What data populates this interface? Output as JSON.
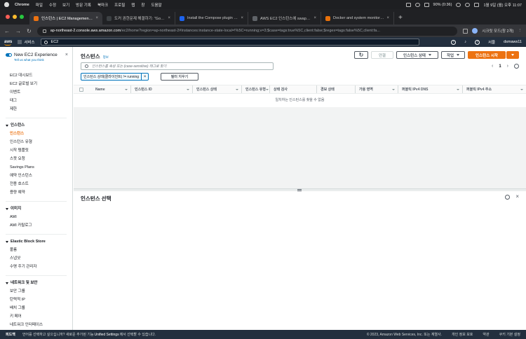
{
  "menubar": {
    "app": "Chrome",
    "items": [
      "파일",
      "수정",
      "보기",
      "방문 기록",
      "북마크",
      "프로필",
      "탭",
      "창",
      "도움말"
    ],
    "battery": "90% (0:36)",
    "datetime": "1월 9일 (월) 오후 11:07"
  },
  "tabs": [
    {
      "title": "인스턴스 | EC2 Management Co",
      "color": "#ec7211",
      "active": true
    },
    {
      "title": "도커 권한문제 해결하기: \"Got perm",
      "color": "#3c4043",
      "active": false
    },
    {
      "title": "Install the Compose plugin | Do",
      "color": "#1d63ed",
      "active": false
    },
    {
      "title": "AWS EC2 인스턴스에 swap 추가하",
      "color": "#5f6368",
      "active": false
    },
    {
      "title": "Docker and system monitoring",
      "color": "#e8710a",
      "active": false
    }
  ],
  "addressbar": {
    "host": "ap-northeast-2.console.aws.amazon.com",
    "path": "/ec2/home?region=ap-northeast-2#Instances:instance-state-local=!%5C=running;v=3;$case=tags:true%5C,client:false;$regex=tags:false%5C,client:fa...",
    "profile": "시크릿 모드(창 2개)"
  },
  "awsnav": {
    "logo": "aws",
    "services": "서비스",
    "search_value": "EC2",
    "region": "서울",
    "user": "dsmaws11"
  },
  "sidebar": {
    "title": "New EC2 Experience",
    "subtitle": "Tell us what you think",
    "top_links": [
      "EC2 대시보드",
      "EC2 글로벌 보기",
      "이벤트",
      "태그",
      "제한"
    ],
    "sections": [
      {
        "title": "인스턴스",
        "items": [
          "인스턴스",
          "인스턴스 유형",
          "시작 템플릿",
          "스팟 요청",
          "Savings Plans",
          "예약 인스턴스",
          "전용 호스트",
          "용량 예약"
        ]
      },
      {
        "title": "이미지",
        "items": [
          "AMI",
          "AMI 카탈로그"
        ]
      },
      {
        "title": "Elastic Block Store",
        "items": [
          "볼륨",
          "스냅샷",
          "수명 주기 관리자"
        ]
      },
      {
        "title": "네트워크 및 보안",
        "items": [
          "보안 그룹",
          "탄력적 IP",
          "배치 그룹",
          "키 페어",
          "네트워크 인터페이스"
        ]
      }
    ]
  },
  "instances": {
    "title": "인스턴스",
    "info": "정보",
    "connect": "연결",
    "state": "인스턴스 상태",
    "actions": "작업",
    "launch": "인스턴스 시작",
    "search_placeholder": "인스턴스를 속성 또는 (case-sensitive) 태그로 찾기",
    "filter_token": "인스턴스 상태(클라이언트) != running",
    "clear_filters": "필터 지우기",
    "page": "1",
    "columns": [
      "Name",
      "인스턴스 ID",
      "인스턴스 상태",
      "인스턴스 유형",
      "상태 검사",
      "경보 상태",
      "가용 영역",
      "퍼블릭 IPv4 DNS",
      "퍼블릭 IPv4 주소"
    ],
    "empty_message": "일치하는 인스턴스를 찾을 수 없음"
  },
  "detail": {
    "title": "인스턴스 선택"
  },
  "footer": {
    "feedback": "피드백",
    "prefix": "언어를 선택하고 싶으십니까? 새로운 추가된 기능",
    "unified": "Unified Settings",
    "suffix": "에서 선택할 수 있습니다.",
    "copyright": "© 2023, Amazon Web Services, Inc. 또는 계열사.",
    "privacy": "개인 정보 보호",
    "terms": "약관",
    "cookies": "쿠키 기본 설정"
  }
}
